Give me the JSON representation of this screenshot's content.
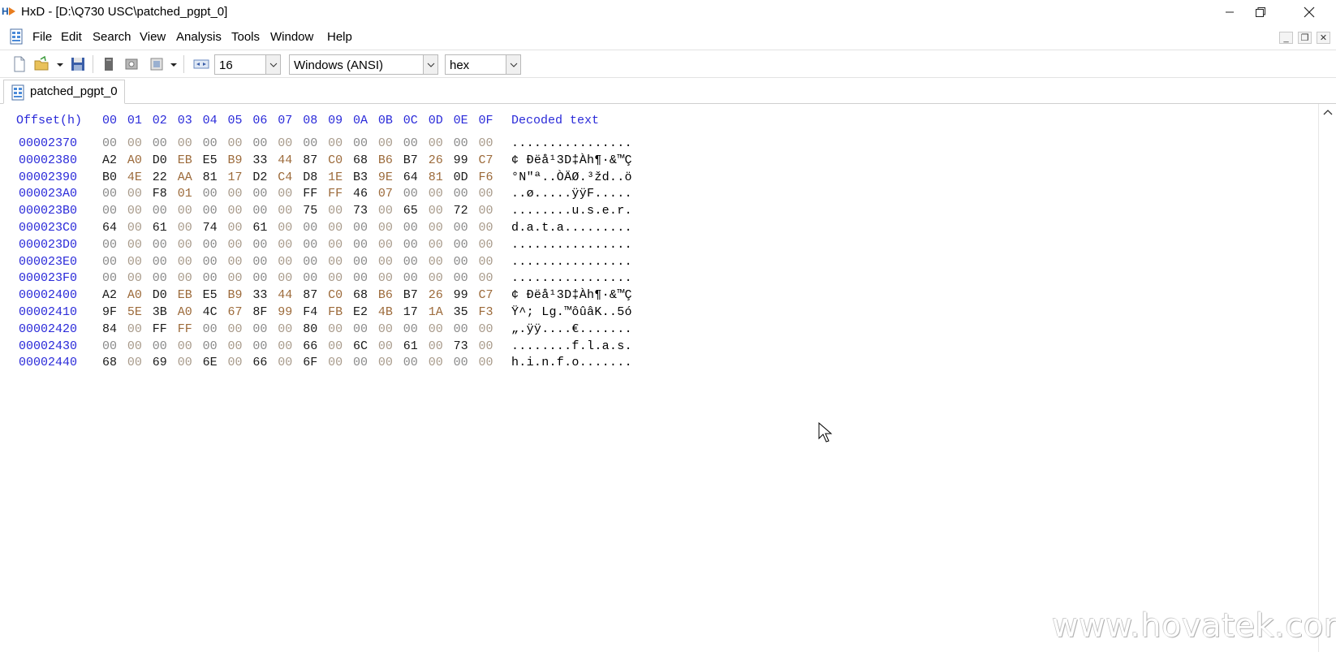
{
  "window": {
    "title": "HxD - [D:\\Q730 USC\\patched_pgpt_0]",
    "minimize": "—",
    "restore": "❐",
    "close": "✕"
  },
  "menu": {
    "items": [
      "File",
      "Edit",
      "Search",
      "View",
      "Analysis",
      "Tools",
      "Window",
      "Help"
    ],
    "mdi_minimize": "_",
    "mdi_restore": "❐",
    "mdi_close": "✕"
  },
  "toolbar": {
    "bytes_per_row": "16",
    "charset": "Windows (ANSI)",
    "offset_base": "hex"
  },
  "tab": {
    "label": "patched_pgpt_0"
  },
  "hex": {
    "offset_header": "Offset(h)",
    "column_headers": [
      "00",
      "01",
      "02",
      "03",
      "04",
      "05",
      "06",
      "07",
      "08",
      "09",
      "0A",
      "0B",
      "0C",
      "0D",
      "0E",
      "0F"
    ],
    "decoded_header": "Decoded text",
    "rows": [
      {
        "offset": "00002370",
        "bytes": [
          "00",
          "00",
          "00",
          "00",
          "00",
          "00",
          "00",
          "00",
          "00",
          "00",
          "00",
          "00",
          "00",
          "00",
          "00",
          "00"
        ],
        "text": "................"
      },
      {
        "offset": "00002380",
        "bytes": [
          "A2",
          "A0",
          "D0",
          "EB",
          "E5",
          "B9",
          "33",
          "44",
          "87",
          "C0",
          "68",
          "B6",
          "B7",
          "26",
          "99",
          "C7"
        ],
        "text": "¢ Ðëå¹3D‡Àh¶·&™Ç"
      },
      {
        "offset": "00002390",
        "bytes": [
          "B0",
          "4E",
          "22",
          "AA",
          "81",
          "17",
          "D2",
          "C4",
          "D8",
          "1E",
          "B3",
          "9E",
          "64",
          "81",
          "0D",
          "F6"
        ],
        "text": "°N\"ª..ÒÄØ.³žd..ö"
      },
      {
        "offset": "000023A0",
        "bytes": [
          "00",
          "00",
          "F8",
          "01",
          "00",
          "00",
          "00",
          "00",
          "FF",
          "FF",
          "46",
          "07",
          "00",
          "00",
          "00",
          "00"
        ],
        "text": "..ø.....ÿÿF....."
      },
      {
        "offset": "000023B0",
        "bytes": [
          "00",
          "00",
          "00",
          "00",
          "00",
          "00",
          "00",
          "00",
          "75",
          "00",
          "73",
          "00",
          "65",
          "00",
          "72",
          "00"
        ],
        "text": "........u.s.e.r."
      },
      {
        "offset": "000023C0",
        "bytes": [
          "64",
          "00",
          "61",
          "00",
          "74",
          "00",
          "61",
          "00",
          "00",
          "00",
          "00",
          "00",
          "00",
          "00",
          "00",
          "00"
        ],
        "text": "d.a.t.a........."
      },
      {
        "offset": "000023D0",
        "bytes": [
          "00",
          "00",
          "00",
          "00",
          "00",
          "00",
          "00",
          "00",
          "00",
          "00",
          "00",
          "00",
          "00",
          "00",
          "00",
          "00"
        ],
        "text": "................"
      },
      {
        "offset": "000023E0",
        "bytes": [
          "00",
          "00",
          "00",
          "00",
          "00",
          "00",
          "00",
          "00",
          "00",
          "00",
          "00",
          "00",
          "00",
          "00",
          "00",
          "00"
        ],
        "text": "................"
      },
      {
        "offset": "000023F0",
        "bytes": [
          "00",
          "00",
          "00",
          "00",
          "00",
          "00",
          "00",
          "00",
          "00",
          "00",
          "00",
          "00",
          "00",
          "00",
          "00",
          "00"
        ],
        "text": "................"
      },
      {
        "offset": "00002400",
        "bytes": [
          "A2",
          "A0",
          "D0",
          "EB",
          "E5",
          "B9",
          "33",
          "44",
          "87",
          "C0",
          "68",
          "B6",
          "B7",
          "26",
          "99",
          "C7"
        ],
        "text": "¢ Ðëå¹3D‡Àh¶·&™Ç"
      },
      {
        "offset": "00002410",
        "bytes": [
          "9F",
          "5E",
          "3B",
          "A0",
          "4C",
          "67",
          "8F",
          "99",
          "F4",
          "FB",
          "E2",
          "4B",
          "17",
          "1A",
          "35",
          "F3"
        ],
        "text": "Ÿ^; Lg.™ôûâK..5ó"
      },
      {
        "offset": "00002420",
        "bytes": [
          "84",
          "00",
          "FF",
          "FF",
          "00",
          "00",
          "00",
          "00",
          "80",
          "00",
          "00",
          "00",
          "00",
          "00",
          "00",
          "00"
        ],
        "text": "„.ÿÿ....€......."
      },
      {
        "offset": "00002430",
        "bytes": [
          "00",
          "00",
          "00",
          "00",
          "00",
          "00",
          "00",
          "00",
          "66",
          "00",
          "6C",
          "00",
          "61",
          "00",
          "73",
          "00"
        ],
        "text": "........f.l.a.s."
      },
      {
        "offset": "00002440",
        "bytes": [
          "68",
          "00",
          "69",
          "00",
          "6E",
          "00",
          "66",
          "00",
          "6F",
          "00",
          "00",
          "00",
          "00",
          "00",
          "00",
          "00"
        ],
        "text": "h.i.n.f.o......."
      }
    ]
  },
  "watermark": "www.hovatek.com",
  "colors": {
    "offset_blue": "#2a2ad9",
    "byte_dark": "#1a1a1a",
    "byte_zero": "#8a8a8a",
    "byte_alt": "#9c6a3a"
  }
}
